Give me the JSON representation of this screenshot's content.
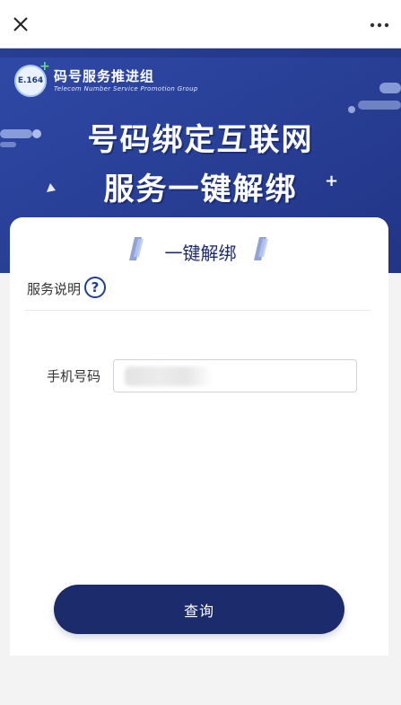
{
  "topbar": {
    "close_icon": "close-icon",
    "more_icon": "more-dots-icon"
  },
  "banner": {
    "org_name": "码号服务推进组",
    "org_name_en": "Telecom Number Service Promotion Group",
    "logo_text": "E.164",
    "headline_line1": "号码绑定互联网",
    "headline_line2": "服务一键解绑",
    "bg_color": "#2a3f95"
  },
  "card": {
    "title": "一键解绑",
    "service_desc_label": "服务说明",
    "help_icon_text": "?",
    "phone_label": "手机号码",
    "phone_value": "",
    "query_label": "查询"
  },
  "colors": {
    "primary": "#1b2b6b",
    "banner": "#2a3f95",
    "page_bg": "#f3f3f3"
  }
}
